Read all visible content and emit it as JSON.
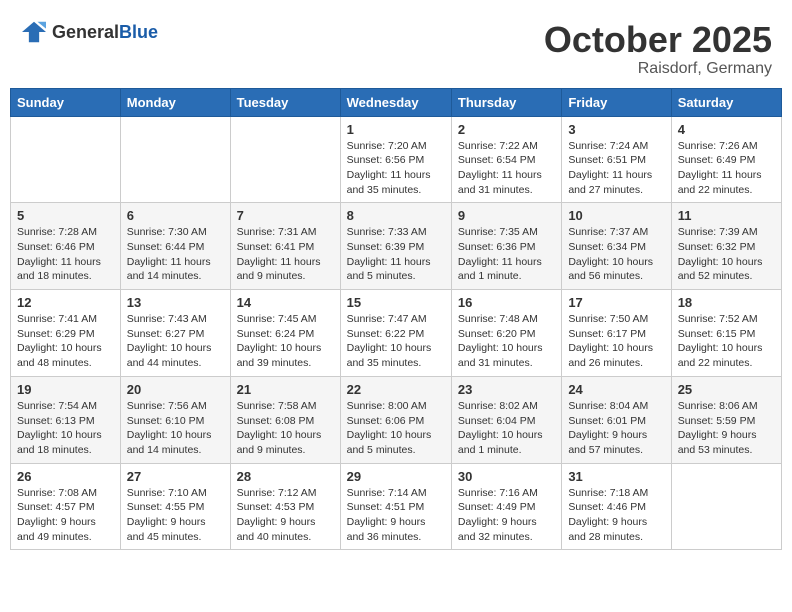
{
  "header": {
    "logo_general": "General",
    "logo_blue": "Blue",
    "month": "October 2025",
    "location": "Raisdorf, Germany"
  },
  "days_of_week": [
    "Sunday",
    "Monday",
    "Tuesday",
    "Wednesday",
    "Thursday",
    "Friday",
    "Saturday"
  ],
  "weeks": [
    [
      {
        "day": "",
        "info": ""
      },
      {
        "day": "",
        "info": ""
      },
      {
        "day": "",
        "info": ""
      },
      {
        "day": "1",
        "info": "Sunrise: 7:20 AM\nSunset: 6:56 PM\nDaylight: 11 hours and 35 minutes."
      },
      {
        "day": "2",
        "info": "Sunrise: 7:22 AM\nSunset: 6:54 PM\nDaylight: 11 hours and 31 minutes."
      },
      {
        "day": "3",
        "info": "Sunrise: 7:24 AM\nSunset: 6:51 PM\nDaylight: 11 hours and 27 minutes."
      },
      {
        "day": "4",
        "info": "Sunrise: 7:26 AM\nSunset: 6:49 PM\nDaylight: 11 hours and 22 minutes."
      }
    ],
    [
      {
        "day": "5",
        "info": "Sunrise: 7:28 AM\nSunset: 6:46 PM\nDaylight: 11 hours and 18 minutes."
      },
      {
        "day": "6",
        "info": "Sunrise: 7:30 AM\nSunset: 6:44 PM\nDaylight: 11 hours and 14 minutes."
      },
      {
        "day": "7",
        "info": "Sunrise: 7:31 AM\nSunset: 6:41 PM\nDaylight: 11 hours and 9 minutes."
      },
      {
        "day": "8",
        "info": "Sunrise: 7:33 AM\nSunset: 6:39 PM\nDaylight: 11 hours and 5 minutes."
      },
      {
        "day": "9",
        "info": "Sunrise: 7:35 AM\nSunset: 6:36 PM\nDaylight: 11 hours and 1 minute."
      },
      {
        "day": "10",
        "info": "Sunrise: 7:37 AM\nSunset: 6:34 PM\nDaylight: 10 hours and 56 minutes."
      },
      {
        "day": "11",
        "info": "Sunrise: 7:39 AM\nSunset: 6:32 PM\nDaylight: 10 hours and 52 minutes."
      }
    ],
    [
      {
        "day": "12",
        "info": "Sunrise: 7:41 AM\nSunset: 6:29 PM\nDaylight: 10 hours and 48 minutes."
      },
      {
        "day": "13",
        "info": "Sunrise: 7:43 AM\nSunset: 6:27 PM\nDaylight: 10 hours and 44 minutes."
      },
      {
        "day": "14",
        "info": "Sunrise: 7:45 AM\nSunset: 6:24 PM\nDaylight: 10 hours and 39 minutes."
      },
      {
        "day": "15",
        "info": "Sunrise: 7:47 AM\nSunset: 6:22 PM\nDaylight: 10 hours and 35 minutes."
      },
      {
        "day": "16",
        "info": "Sunrise: 7:48 AM\nSunset: 6:20 PM\nDaylight: 10 hours and 31 minutes."
      },
      {
        "day": "17",
        "info": "Sunrise: 7:50 AM\nSunset: 6:17 PM\nDaylight: 10 hours and 26 minutes."
      },
      {
        "day": "18",
        "info": "Sunrise: 7:52 AM\nSunset: 6:15 PM\nDaylight: 10 hours and 22 minutes."
      }
    ],
    [
      {
        "day": "19",
        "info": "Sunrise: 7:54 AM\nSunset: 6:13 PM\nDaylight: 10 hours and 18 minutes."
      },
      {
        "day": "20",
        "info": "Sunrise: 7:56 AM\nSunset: 6:10 PM\nDaylight: 10 hours and 14 minutes."
      },
      {
        "day": "21",
        "info": "Sunrise: 7:58 AM\nSunset: 6:08 PM\nDaylight: 10 hours and 9 minutes."
      },
      {
        "day": "22",
        "info": "Sunrise: 8:00 AM\nSunset: 6:06 PM\nDaylight: 10 hours and 5 minutes."
      },
      {
        "day": "23",
        "info": "Sunrise: 8:02 AM\nSunset: 6:04 PM\nDaylight: 10 hours and 1 minute."
      },
      {
        "day": "24",
        "info": "Sunrise: 8:04 AM\nSunset: 6:01 PM\nDaylight: 9 hours and 57 minutes."
      },
      {
        "day": "25",
        "info": "Sunrise: 8:06 AM\nSunset: 5:59 PM\nDaylight: 9 hours and 53 minutes."
      }
    ],
    [
      {
        "day": "26",
        "info": "Sunrise: 7:08 AM\nSunset: 4:57 PM\nDaylight: 9 hours and 49 minutes."
      },
      {
        "day": "27",
        "info": "Sunrise: 7:10 AM\nSunset: 4:55 PM\nDaylight: 9 hours and 45 minutes."
      },
      {
        "day": "28",
        "info": "Sunrise: 7:12 AM\nSunset: 4:53 PM\nDaylight: 9 hours and 40 minutes."
      },
      {
        "day": "29",
        "info": "Sunrise: 7:14 AM\nSunset: 4:51 PM\nDaylight: 9 hours and 36 minutes."
      },
      {
        "day": "30",
        "info": "Sunrise: 7:16 AM\nSunset: 4:49 PM\nDaylight: 9 hours and 32 minutes."
      },
      {
        "day": "31",
        "info": "Sunrise: 7:18 AM\nSunset: 4:46 PM\nDaylight: 9 hours and 28 minutes."
      },
      {
        "day": "",
        "info": ""
      }
    ]
  ]
}
